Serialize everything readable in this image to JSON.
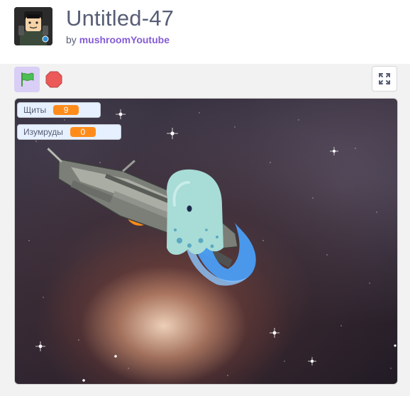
{
  "project": {
    "title": "Untitled-47",
    "by_label": "by",
    "author": "mushroomYoutube"
  },
  "controls": {
    "green_flag_icon": "green-flag-icon",
    "stop_icon": "stop-sign-icon",
    "fullscreen_icon": "fullscreen-icon"
  },
  "monitors": [
    {
      "label": "Щиты",
      "value": "9"
    },
    {
      "label": "Изумруды",
      "value": "0"
    }
  ],
  "colors": {
    "accent": "#855cd6",
    "monitor_value": "#ff8c1a",
    "flag_bg": "#d9cef5"
  }
}
